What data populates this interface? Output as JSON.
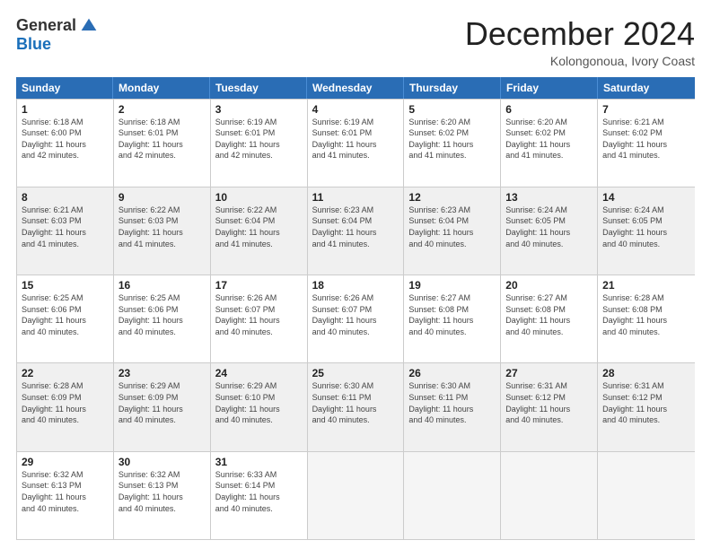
{
  "logo": {
    "general": "General",
    "blue": "Blue"
  },
  "title": "December 2024",
  "subtitle": "Kolongonoua, Ivory Coast",
  "header_days": [
    "Sunday",
    "Monday",
    "Tuesday",
    "Wednesday",
    "Thursday",
    "Friday",
    "Saturday"
  ],
  "weeks": [
    [
      {
        "day": "1",
        "info": "Sunrise: 6:18 AM\nSunset: 6:00 PM\nDaylight: 11 hours\nand 42 minutes.",
        "shaded": false
      },
      {
        "day": "2",
        "info": "Sunrise: 6:18 AM\nSunset: 6:01 PM\nDaylight: 11 hours\nand 42 minutes.",
        "shaded": false
      },
      {
        "day": "3",
        "info": "Sunrise: 6:19 AM\nSunset: 6:01 PM\nDaylight: 11 hours\nand 42 minutes.",
        "shaded": false
      },
      {
        "day": "4",
        "info": "Sunrise: 6:19 AM\nSunset: 6:01 PM\nDaylight: 11 hours\nand 41 minutes.",
        "shaded": false
      },
      {
        "day": "5",
        "info": "Sunrise: 6:20 AM\nSunset: 6:02 PM\nDaylight: 11 hours\nand 41 minutes.",
        "shaded": false
      },
      {
        "day": "6",
        "info": "Sunrise: 6:20 AM\nSunset: 6:02 PM\nDaylight: 11 hours\nand 41 minutes.",
        "shaded": false
      },
      {
        "day": "7",
        "info": "Sunrise: 6:21 AM\nSunset: 6:02 PM\nDaylight: 11 hours\nand 41 minutes.",
        "shaded": false
      }
    ],
    [
      {
        "day": "8",
        "info": "Sunrise: 6:21 AM\nSunset: 6:03 PM\nDaylight: 11 hours\nand 41 minutes.",
        "shaded": true
      },
      {
        "day": "9",
        "info": "Sunrise: 6:22 AM\nSunset: 6:03 PM\nDaylight: 11 hours\nand 41 minutes.",
        "shaded": true
      },
      {
        "day": "10",
        "info": "Sunrise: 6:22 AM\nSunset: 6:04 PM\nDaylight: 11 hours\nand 41 minutes.",
        "shaded": true
      },
      {
        "day": "11",
        "info": "Sunrise: 6:23 AM\nSunset: 6:04 PM\nDaylight: 11 hours\nand 41 minutes.",
        "shaded": true
      },
      {
        "day": "12",
        "info": "Sunrise: 6:23 AM\nSunset: 6:04 PM\nDaylight: 11 hours\nand 40 minutes.",
        "shaded": true
      },
      {
        "day": "13",
        "info": "Sunrise: 6:24 AM\nSunset: 6:05 PM\nDaylight: 11 hours\nand 40 minutes.",
        "shaded": true
      },
      {
        "day": "14",
        "info": "Sunrise: 6:24 AM\nSunset: 6:05 PM\nDaylight: 11 hours\nand 40 minutes.",
        "shaded": true
      }
    ],
    [
      {
        "day": "15",
        "info": "Sunrise: 6:25 AM\nSunset: 6:06 PM\nDaylight: 11 hours\nand 40 minutes.",
        "shaded": false
      },
      {
        "day": "16",
        "info": "Sunrise: 6:25 AM\nSunset: 6:06 PM\nDaylight: 11 hours\nand 40 minutes.",
        "shaded": false
      },
      {
        "day": "17",
        "info": "Sunrise: 6:26 AM\nSunset: 6:07 PM\nDaylight: 11 hours\nand 40 minutes.",
        "shaded": false
      },
      {
        "day": "18",
        "info": "Sunrise: 6:26 AM\nSunset: 6:07 PM\nDaylight: 11 hours\nand 40 minutes.",
        "shaded": false
      },
      {
        "day": "19",
        "info": "Sunrise: 6:27 AM\nSunset: 6:08 PM\nDaylight: 11 hours\nand 40 minutes.",
        "shaded": false
      },
      {
        "day": "20",
        "info": "Sunrise: 6:27 AM\nSunset: 6:08 PM\nDaylight: 11 hours\nand 40 minutes.",
        "shaded": false
      },
      {
        "day": "21",
        "info": "Sunrise: 6:28 AM\nSunset: 6:08 PM\nDaylight: 11 hours\nand 40 minutes.",
        "shaded": false
      }
    ],
    [
      {
        "day": "22",
        "info": "Sunrise: 6:28 AM\nSunset: 6:09 PM\nDaylight: 11 hours\nand 40 minutes.",
        "shaded": true
      },
      {
        "day": "23",
        "info": "Sunrise: 6:29 AM\nSunset: 6:09 PM\nDaylight: 11 hours\nand 40 minutes.",
        "shaded": true
      },
      {
        "day": "24",
        "info": "Sunrise: 6:29 AM\nSunset: 6:10 PM\nDaylight: 11 hours\nand 40 minutes.",
        "shaded": true
      },
      {
        "day": "25",
        "info": "Sunrise: 6:30 AM\nSunset: 6:11 PM\nDaylight: 11 hours\nand 40 minutes.",
        "shaded": true
      },
      {
        "day": "26",
        "info": "Sunrise: 6:30 AM\nSunset: 6:11 PM\nDaylight: 11 hours\nand 40 minutes.",
        "shaded": true
      },
      {
        "day": "27",
        "info": "Sunrise: 6:31 AM\nSunset: 6:12 PM\nDaylight: 11 hours\nand 40 minutes.",
        "shaded": true
      },
      {
        "day": "28",
        "info": "Sunrise: 6:31 AM\nSunset: 6:12 PM\nDaylight: 11 hours\nand 40 minutes.",
        "shaded": true
      }
    ],
    [
      {
        "day": "29",
        "info": "Sunrise: 6:32 AM\nSunset: 6:13 PM\nDaylight: 11 hours\nand 40 minutes.",
        "shaded": false
      },
      {
        "day": "30",
        "info": "Sunrise: 6:32 AM\nSunset: 6:13 PM\nDaylight: 11 hours\nand 40 minutes.",
        "shaded": false
      },
      {
        "day": "31",
        "info": "Sunrise: 6:33 AM\nSunset: 6:14 PM\nDaylight: 11 hours\nand 40 minutes.",
        "shaded": false
      },
      {
        "day": "",
        "info": "",
        "shaded": false,
        "empty": true
      },
      {
        "day": "",
        "info": "",
        "shaded": false,
        "empty": true
      },
      {
        "day": "",
        "info": "",
        "shaded": false,
        "empty": true
      },
      {
        "day": "",
        "info": "",
        "shaded": false,
        "empty": true
      }
    ]
  ]
}
